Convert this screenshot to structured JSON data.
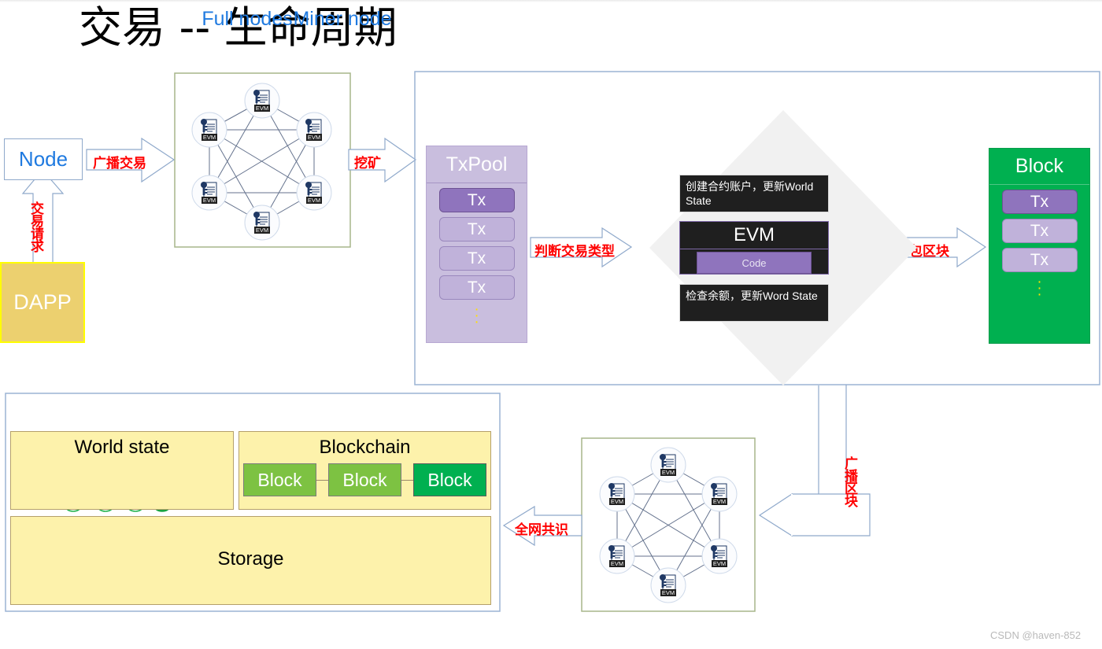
{
  "title": "交易 -- 生命周期",
  "watermark": "CSDN @haven-852",
  "left": {
    "node_label": "Node",
    "dapp_label": "DAPP",
    "arrow_tx_request": "交易请求",
    "arrow_broadcast_tx": "广播交易",
    "arrow_mining": "挖矿"
  },
  "p2p_network_top": {
    "node_icon": "evm-node-icon",
    "node_label": "EVM",
    "node_count": 6
  },
  "miner": {
    "title": "Miner node",
    "txpool": {
      "header": "TxPool",
      "items": [
        "Tx",
        "Tx",
        "Tx",
        "Tx"
      ],
      "ellipsis": "⋮"
    },
    "arrow_judge_type": "判断交易类型",
    "diamond": {
      "top_box": "创建合约账户，更新World State",
      "evm_title": "EVM",
      "evm_code": "Code",
      "bottom_box": "检查余额，更新Word State"
    },
    "arrow_pack_block": "打包区块",
    "block": {
      "header": "Block",
      "items": [
        "Tx",
        "Tx",
        "Tx"
      ],
      "ellipsis": "⋮"
    }
  },
  "arrow_broadcast_block": "广播区块",
  "arrow_consensus": "全网共识",
  "p2p_network_bottom": {
    "node_icon": "evm-node-icon",
    "node_label": "EVM",
    "node_count": 6
  },
  "full_nodes": {
    "title": "Full nodes",
    "world_state": {
      "title": "World state",
      "tree_nodes": 7,
      "filled_leaf_index": 3
    },
    "blockchain": {
      "title": "Blockchain",
      "blocks": [
        "Block",
        "Block",
        "Block"
      ]
    },
    "storage": {
      "title": "Storage"
    }
  },
  "colors": {
    "accent_blue": "#1f7ae0",
    "red_label": "#ff0000",
    "txpool_purple": "#c9bede",
    "tx_active_purple": "#8f74bd",
    "block_green": "#00b050",
    "chain_block_green": "#7dc242",
    "yellow_panel": "#fdf2ab",
    "dapp_gold": "#ecd06f",
    "diamond_grey": "#f1f1f1"
  }
}
